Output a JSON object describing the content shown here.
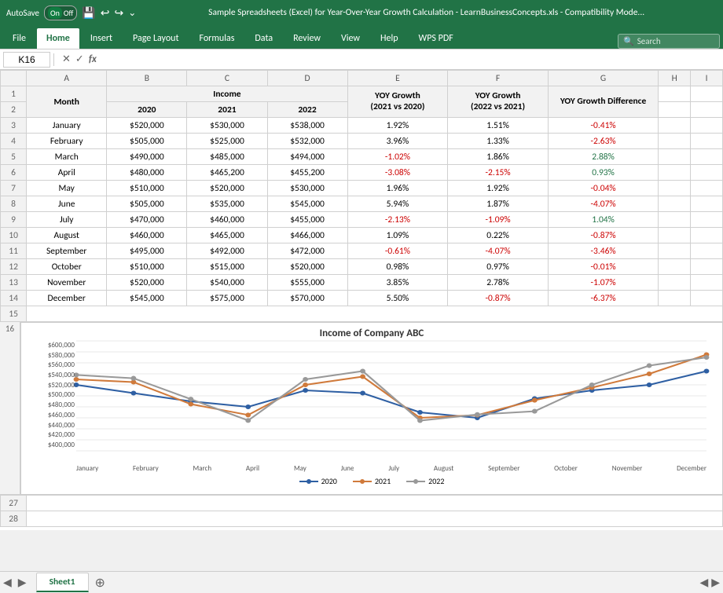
{
  "titleBar": {
    "autosave": "AutoSave",
    "on": "On",
    "off": "Off",
    "title": "Sample Spreadsheets (Excel) for Year-Over-Year Growth Calculation - LearnBusinessConcepts.xls - Compatibility Mode...",
    "saveIcon": "💾",
    "undoIcon": "↩",
    "redoIcon": "↪"
  },
  "ribbon": {
    "tabs": [
      "File",
      "Home",
      "Insert",
      "Page Layout",
      "Formulas",
      "Data",
      "Review",
      "View",
      "Help",
      "WPS PDF"
    ],
    "activeTab": "Home",
    "search": "Search"
  },
  "formulaBar": {
    "cellRef": "K16",
    "formula": ""
  },
  "columns": {
    "headers": [
      "",
      "A",
      "B",
      "C",
      "D",
      "E",
      "F",
      "G",
      "H",
      "I"
    ],
    "widths": [
      26,
      80,
      80,
      80,
      80,
      100,
      100,
      100,
      30,
      30
    ]
  },
  "rows": [
    {
      "num": 1,
      "cells": [
        "Month",
        "Income",
        "",
        "",
        "YOY Growth\n(2021 vs 2020)",
        "YOY Growth\n(2022 vs 2021)",
        "YOY Growth Difference",
        "",
        ""
      ]
    },
    {
      "num": 2,
      "cells": [
        "",
        "2020",
        "2021",
        "2022",
        "",
        "",
        "",
        "",
        ""
      ]
    },
    {
      "num": 3,
      "month": "January",
      "b": "$520,000",
      "c": "$530,000",
      "d": "$538,000",
      "e": "1.92%",
      "f": "1.51%",
      "g": "-0.41%"
    },
    {
      "num": 4,
      "month": "February",
      "b": "$505,000",
      "c": "$525,000",
      "d": "$532,000",
      "e": "3.96%",
      "f": "1.33%",
      "g": "-2.63%"
    },
    {
      "num": 5,
      "month": "March",
      "b": "$490,000",
      "c": "$485,000",
      "d": "$494,000",
      "e": "-1.02%",
      "f": "1.86%",
      "g": "2.88%"
    },
    {
      "num": 6,
      "month": "April",
      "b": "$480,000",
      "c": "$465,200",
      "d": "$455,200",
      "e": "-3.08%",
      "f": "-2.15%",
      "g": "0.93%"
    },
    {
      "num": 7,
      "month": "May",
      "b": "$510,000",
      "c": "$520,000",
      "d": "$530,000",
      "e": "1.96%",
      "f": "1.92%",
      "g": "-0.04%"
    },
    {
      "num": 8,
      "month": "June",
      "b": "$505,000",
      "c": "$535,000",
      "d": "$545,000",
      "e": "5.94%",
      "f": "1.87%",
      "g": "-4.07%"
    },
    {
      "num": 9,
      "month": "July",
      "b": "$470,000",
      "c": "$460,000",
      "d": "$455,000",
      "e": "-2.13%",
      "f": "-1.09%",
      "g": "1.04%"
    },
    {
      "num": 10,
      "month": "August",
      "b": "$460,000",
      "c": "$465,000",
      "d": "$466,000",
      "e": "1.09%",
      "f": "0.22%",
      "g": "-0.87%"
    },
    {
      "num": 11,
      "month": "September",
      "b": "$495,000",
      "c": "$492,000",
      "d": "$472,000",
      "e": "-0.61%",
      "f": "-4.07%",
      "g": "-3.46%"
    },
    {
      "num": 12,
      "month": "October",
      "b": "$510,000",
      "c": "$515,000",
      "d": "$520,000",
      "e": "0.98%",
      "f": "0.97%",
      "g": "-0.01%"
    },
    {
      "num": 13,
      "month": "November",
      "b": "$520,000",
      "c": "$540,000",
      "d": "$555,000",
      "e": "3.85%",
      "f": "2.78%",
      "g": "-1.07%"
    },
    {
      "num": 14,
      "month": "December",
      "b": "$545,000",
      "c": "$575,000",
      "d": "$570,000",
      "e": "5.50%",
      "f": "-0.87%",
      "g": "-6.37%"
    }
  ],
  "chart": {
    "title": "Income of Company ABC",
    "yLabels": [
      "$600,000",
      "$580,000",
      "$560,000",
      "$540,000",
      "$520,000",
      "$500,000",
      "$480,000",
      "$460,000",
      "$440,000",
      "$420,000",
      "$400,000"
    ],
    "xLabels": [
      "January",
      "February",
      "March",
      "April",
      "May",
      "June",
      "July",
      "August",
      "September",
      "October",
      "November",
      "December"
    ],
    "legend": [
      "2020",
      "2021",
      "2022"
    ],
    "series2020": [
      520,
      505,
      490,
      480,
      510,
      505,
      470,
      460,
      495,
      510,
      520,
      545
    ],
    "series2021": [
      530,
      525,
      485,
      465.2,
      520,
      535,
      460,
      465,
      492,
      515,
      540,
      575
    ],
    "series2022": [
      538,
      532,
      494,
      455.2,
      530,
      545,
      455,
      466,
      472,
      520,
      555,
      570
    ],
    "colors": {
      "2020": "#2e5fa3",
      "2021": "#d07a3b",
      "2022": "#888888"
    }
  },
  "sheetTabs": [
    "Sheet1"
  ],
  "activeSheet": "Sheet1"
}
